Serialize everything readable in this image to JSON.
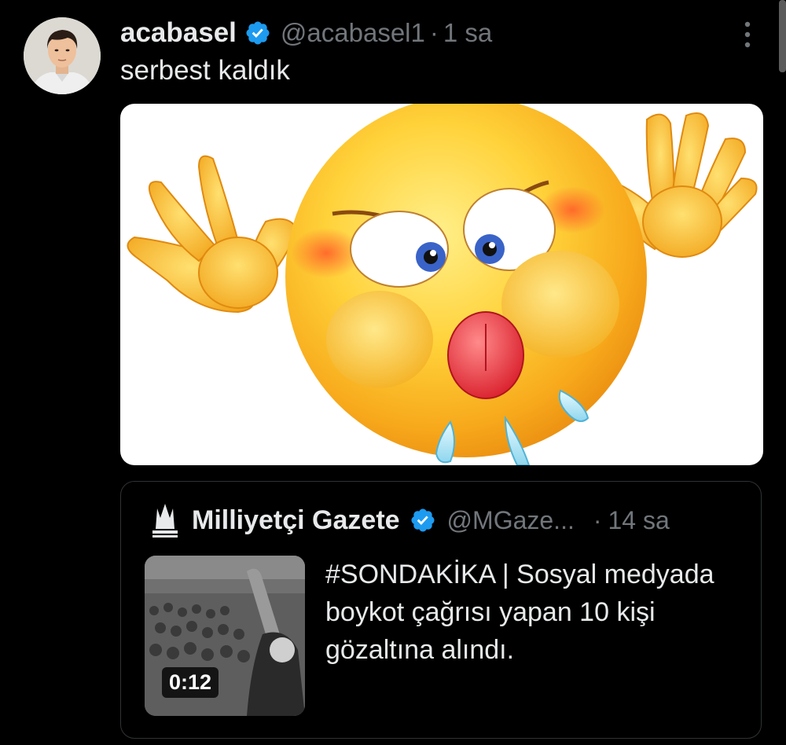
{
  "tweet": {
    "display_name": "acabasel",
    "handle": "@acabasel1",
    "separator": "·",
    "time": "1 sa",
    "text": "serbest kaldık",
    "media": {
      "description": "angry emoji"
    }
  },
  "quote": {
    "display_name": "Milliyetçi Gazete",
    "handle": "@MGaze...",
    "separator": "·",
    "time": "14 sa",
    "text": "#SONDAKİKA | Sosyal medyada boykot çağrısı yapan 10 kişi gözaltına alındı.",
    "video_duration": "0:12"
  },
  "colors": {
    "background": "#000000",
    "text_primary": "#e7e9ea",
    "text_secondary": "#71767b",
    "verified_blue": "#1d9bf0",
    "border": "#2f3336"
  },
  "icons": {
    "verified": "verified-badge-icon",
    "more": "more-vertical-icon",
    "publisher_logo": "gazette-logo"
  }
}
